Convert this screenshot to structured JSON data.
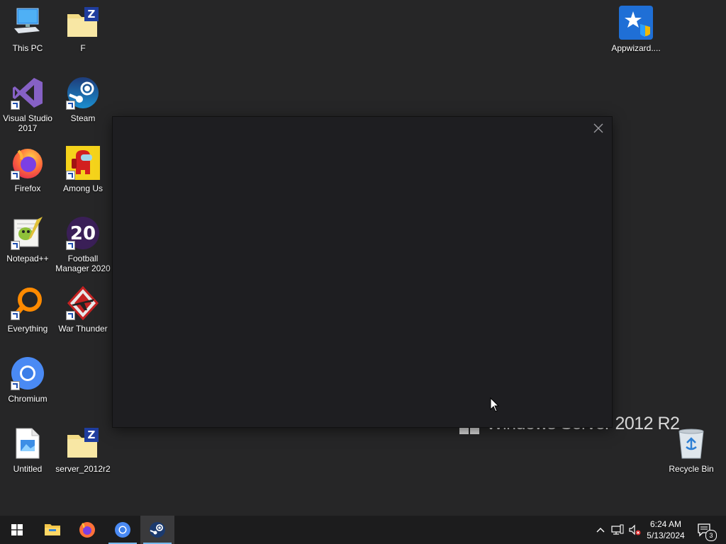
{
  "desktop": {
    "wallpaper_text": "Windows Server 2012 R2",
    "icons": [
      {
        "label": "This PC"
      },
      {
        "label": "F"
      },
      {
        "label": "Visual Studio\n2017"
      },
      {
        "label": "Steam"
      },
      {
        "label": "Firefox"
      },
      {
        "label": "Among Us"
      },
      {
        "label": "Notepad++"
      },
      {
        "label": "Football\nManager 2020"
      },
      {
        "label": "Everything"
      },
      {
        "label": "War Thunder"
      },
      {
        "label": "Chromium"
      },
      {
        "label": "Untitled"
      },
      {
        "label": "server_2012r2"
      },
      {
        "label": "Appwizard...."
      },
      {
        "label": "Recycle Bin"
      }
    ]
  },
  "dialog": {
    "close_icon": "close-icon"
  },
  "taskbar": {
    "apps": [
      {
        "name": "start-button",
        "icon": "windows-logo-icon"
      },
      {
        "name": "file-explorer",
        "icon": "folder-icon"
      },
      {
        "name": "firefox",
        "icon": "firefox-icon"
      },
      {
        "name": "chromium",
        "icon": "chromium-icon"
      },
      {
        "name": "steam",
        "icon": "steam-icon"
      }
    ],
    "tray": {
      "time": "6:24 AM",
      "date": "5/13/2024",
      "notification_count": "3"
    }
  },
  "colors": {
    "desktop_bg": "#262627",
    "taskbar_bg": "#1c1c1d",
    "dialog_bg": "#1e1e21",
    "accent": "#76b9ed"
  }
}
